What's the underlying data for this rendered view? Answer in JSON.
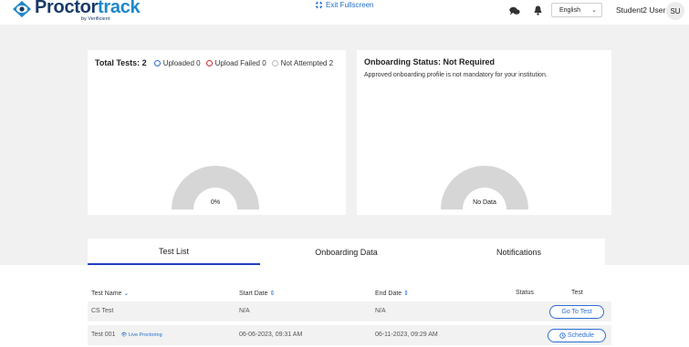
{
  "header": {
    "logo_main": "Proctor",
    "logo_accent": "track",
    "logo_sub": "by Verificient",
    "exit_fullscreen": "Exit Fullscreen",
    "language": "English",
    "user_name": "Student2 User",
    "avatar_initials": "SU"
  },
  "summary": {
    "total_tests": "Total Tests: 2",
    "legend": [
      {
        "label": "Uploaded 0",
        "color": "#2b6fd6"
      },
      {
        "label": "Upload Failed 0",
        "color": "#d62b2b"
      },
      {
        "label": "Not Attempted 2",
        "color": "#bbbbbb"
      }
    ],
    "gauge_label": "0%"
  },
  "onboarding": {
    "title": "Onboarding Status: Not Required",
    "description": "Approved onboarding profile is not mandatory for your institution.",
    "gauge_label": "No Data"
  },
  "tabs": [
    {
      "label": "Test List",
      "active": true
    },
    {
      "label": "Onboarding Data",
      "active": false
    },
    {
      "label": "Notifications",
      "active": false
    }
  ],
  "table": {
    "headers": [
      "Test Name",
      "Start Date",
      "End Date",
      "Status",
      "Test"
    ],
    "rows": [
      {
        "name": "CS Test",
        "badge": "",
        "start": "N/A",
        "end": "N/A",
        "status": "",
        "action": "Go To Test"
      },
      {
        "name": "Test 001",
        "badge": "Live Proctoring",
        "start": "06-06-2023, 09:31 AM",
        "end": "06-11-2023, 09:29 AM",
        "status": "",
        "action": "Schedule"
      }
    ]
  },
  "colors": {
    "accent": "#1e88c9",
    "brand_dark": "#1a3a66",
    "tab_active": "#1f3fbf",
    "button": "#2b6fd6",
    "gauge": "#d6d6d6"
  }
}
